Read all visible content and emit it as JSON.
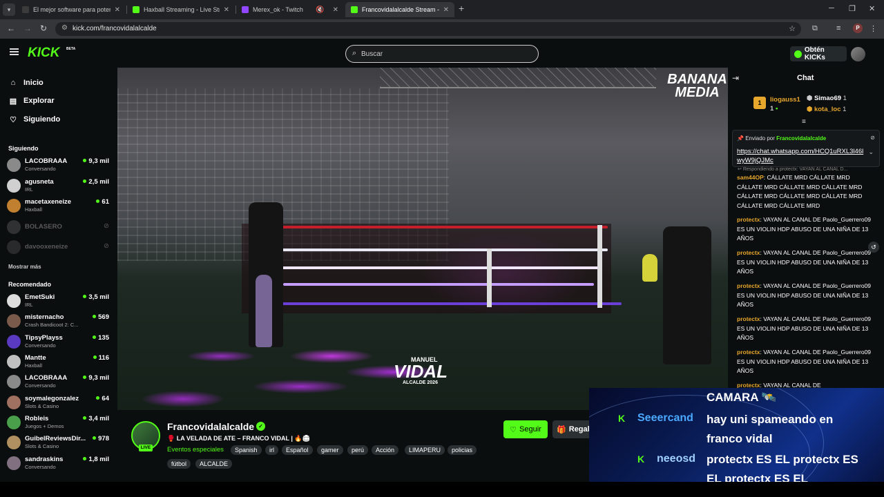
{
  "browser": {
    "tabs": [
      {
        "title": "El mejor software para potenciar",
        "favicon_color": "#3b3b3b"
      },
      {
        "title": "Haxball Streaming - Live Stream",
        "favicon_color": "#53fc18"
      },
      {
        "title": "Merex_ok - Twitch",
        "favicon_color": "#9146ff"
      },
      {
        "title": "Francovidalalcalde Stream - Wa",
        "favicon_color": "#53fc18"
      }
    ],
    "url": "kick.com/francovidalalcalde",
    "profile_initial": "P"
  },
  "header": {
    "logo": "KICK",
    "beta": "BETA",
    "search_placeholder": "Buscar",
    "kicks_button": "Obtén KICKs"
  },
  "sidebar": {
    "nav": [
      {
        "label": "Inicio",
        "icon": "home-icon"
      },
      {
        "label": "Explorar",
        "icon": "browse-icon"
      },
      {
        "label": "Siguiendo",
        "icon": "heart-icon"
      }
    ],
    "following_title": "Siguiendo",
    "following": [
      {
        "name": "LACOBRAAA",
        "category": "Conversando",
        "viewers": "9,3 mil",
        "color": "#8a8a8a"
      },
      {
        "name": "agusneta",
        "category": "IRL",
        "viewers": "2,5 mil",
        "color": "#d0d0d0"
      },
      {
        "name": "macetaxeneize",
        "category": "Haxball",
        "viewers": "61",
        "color": "#c08030"
      },
      {
        "name": "BOLASERO",
        "category": "",
        "viewers": "",
        "color": "#666"
      },
      {
        "name": "davooxeneize",
        "category": "",
        "viewers": "",
        "color": "#555"
      }
    ],
    "show_more": "Mostrar más",
    "recommended_title": "Recomendado",
    "recommended": [
      {
        "name": "EmetSuki",
        "category": "IRL",
        "viewers": "3,5 mil",
        "color": "#ddd"
      },
      {
        "name": "misternacho",
        "category": "Crash Bandicoot 2: C...",
        "viewers": "569",
        "color": "#7a5a4a"
      },
      {
        "name": "TipsyPlayss",
        "category": "Conversando",
        "viewers": "135",
        "color": "#5a3ac0"
      },
      {
        "name": "Mantte",
        "category": "Haxball",
        "viewers": "116",
        "color": "#c0c0c0"
      },
      {
        "name": "LACOBRAAA",
        "category": "Conversando",
        "viewers": "9,3 mil",
        "color": "#8a8a8a"
      },
      {
        "name": "soymalegonzalez",
        "category": "Slots & Casino",
        "viewers": "64",
        "color": "#a07060"
      },
      {
        "name": "Robleis",
        "category": "Juegos + Demos",
        "viewers": "3,4 mil",
        "color": "#4aa04a"
      },
      {
        "name": "GuibelReviewsDir...",
        "category": "Slots & Casino",
        "viewers": "978",
        "color": "#b09060"
      },
      {
        "name": "sandraskins",
        "category": "Conversando",
        "viewers": "1,8 mil",
        "color": "#807080"
      }
    ]
  },
  "video": {
    "watermark": "BANANA MEDIA",
    "banner_top": "MANUEL",
    "banner_main": "VIDAL",
    "banner_sub": "ALCALDE 2026"
  },
  "stream": {
    "streamer": "Francovidalalcalde",
    "live_label": "LIVE",
    "title": "🥊 LA VELADA DE ATE – FRANCO VIDAL | 🔥🏟",
    "category": "Eventos especiales",
    "tags": [
      "Spanish",
      "irl",
      "Español",
      "gamer",
      "perú",
      "Acción",
      "LIMAPERU",
      "policias",
      "fútbol",
      "ALCALDE"
    ],
    "follow_label": "Seguir",
    "gift_label": "Regala"
  },
  "chat": {
    "title": "Chat",
    "leaderboard": [
      {
        "rank": "1",
        "name": "liogauss1",
        "count": "1",
        "color": "#e7a72c"
      },
      {
        "name": "Simao69",
        "count": "1",
        "color": "#ffffff"
      },
      {
        "name": "kota_loc",
        "count": "1",
        "color": "#e7a72c"
      }
    ],
    "pinned_prefix": "Enviado por",
    "pinned_by": "Francovidalalcalde",
    "pinned_link": "https://chat.whatsapp.com/HCQ1uRXL3l46lwyW9jQJMc",
    "reply_hint": "Respondiendo a protectx: VAYAN AL CANAL D...",
    "messages": [
      {
        "user": "sam44OP",
        "text": ": CÁLLATE MRD CÁLLATE MRD CÁLLATE MRD CÁLLATE MRD CÁLLATE MRD CÁLLATE MRD CÁLLATE MRD CÁLLATE MRD CÁLLATE MRD CÁLLATE MRD",
        "color": "#e7a72c"
      },
      {
        "user": "protectx",
        "text": ": VAYAN AL CANAL DE Paolo_Guerrero09 ES UN VIOLIN HDP ABUSO DE UNA NIÑA DE 13 AÑOS",
        "color": "#e7a72c"
      },
      {
        "user": "protectx",
        "text": ": VAYAN AL CANAL DE Paolo_Guerrero09 ES UN VIOLIN HDP ABUSO DE UNA NIÑA DE 13 AÑOS",
        "color": "#e7a72c"
      },
      {
        "user": "protectx",
        "text": ": VAYAN AL CANAL DE Paolo_Guerrero09 ES UN VIOLIN HDP ABUSO DE UNA NIÑA DE 13 AÑOS",
        "color": "#e7a72c"
      },
      {
        "user": "protectx",
        "text": ": VAYAN AL CANAL DE Paolo_Guerrero09 ES UN VIOLIN HDP ABUSO DE UNA NIÑA DE 13 AÑOS",
        "color": "#e7a72c"
      },
      {
        "user": "protectx",
        "text": ": VAYAN AL CANAL DE Paolo_Guerrero09 ES UN VIOLIN HDP ABUSO DE UNA NIÑA DE 13 AÑOS",
        "color": "#e7a72c"
      },
      {
        "user": "protectx",
        "text": ": VAYAN AL CANAL DE",
        "color": "#e7a72c"
      }
    ]
  },
  "overlay": {
    "top_line": "CAMARA 🛰️",
    "user1": "Seeercand",
    "msg1_line1": "hay uni spameando en",
    "msg1_line2": "franco vidal",
    "user2": "neeosd",
    "msg2_line1": "protectx ES EL protectx ES",
    "msg2_line2": "EL protectx ES EL",
    "user1_color": "#4aa8ff",
    "user2_color": "#9fd0ff",
    "k_icon": "K"
  }
}
